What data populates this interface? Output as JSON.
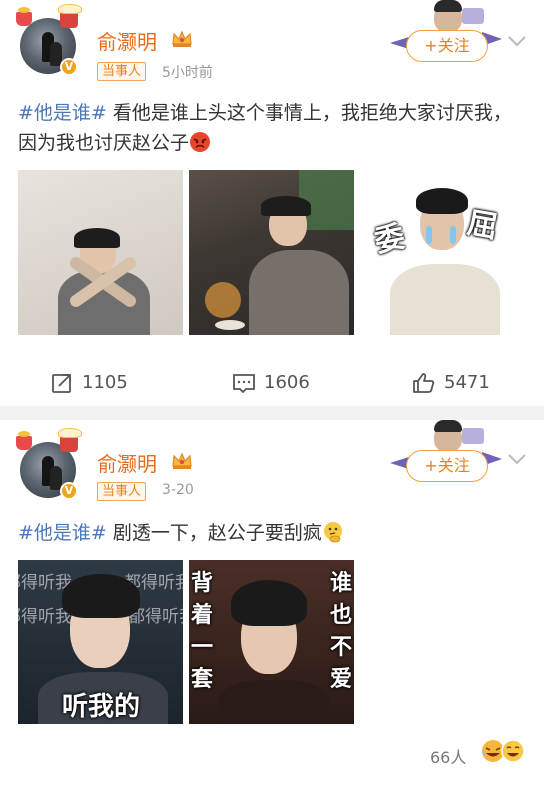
{
  "posts": [
    {
      "author": "俞灏明",
      "tag": "当事人",
      "time": "5小时前",
      "follow_label": "+关注",
      "hashtag": "#他是谁#",
      "text": " 看他是谁上头这个事情上，我拒绝大家讨厌我，因为我也讨厌赵公子",
      "image3_text": [
        "委",
        "屈"
      ],
      "actions": {
        "repost": "1105",
        "comment": "1606",
        "like": "5471"
      }
    },
    {
      "author": "俞灏明",
      "tag": "当事人",
      "time": "3-20",
      "follow_label": "+关注",
      "hashtag": "#他是谁#",
      "text": " 剧透一下，赵公子要刮疯",
      "image1_caption": "听我的",
      "image1_watermark": [
        "部得听我",
        "都得听我",
        "部得听我",
        "都得听我"
      ],
      "image2_text_left": [
        "背",
        "着",
        "一",
        "套"
      ],
      "image2_text_right": [
        "谁",
        "也",
        "不",
        "爱"
      ],
      "likes": "66人"
    }
  ],
  "colors": {
    "name": "#e86b17",
    "hashtag": "#4a78b8",
    "follow": "#e8811b",
    "tag_border": "#f0a35b"
  },
  "icons": [
    "verified-badge-icon",
    "crown-icon",
    "chevron-down-icon",
    "repost-icon",
    "comment-icon",
    "like-icon",
    "angry-emoji-icon",
    "thinking-emoji-icon",
    "laugh-emoji-icon"
  ]
}
